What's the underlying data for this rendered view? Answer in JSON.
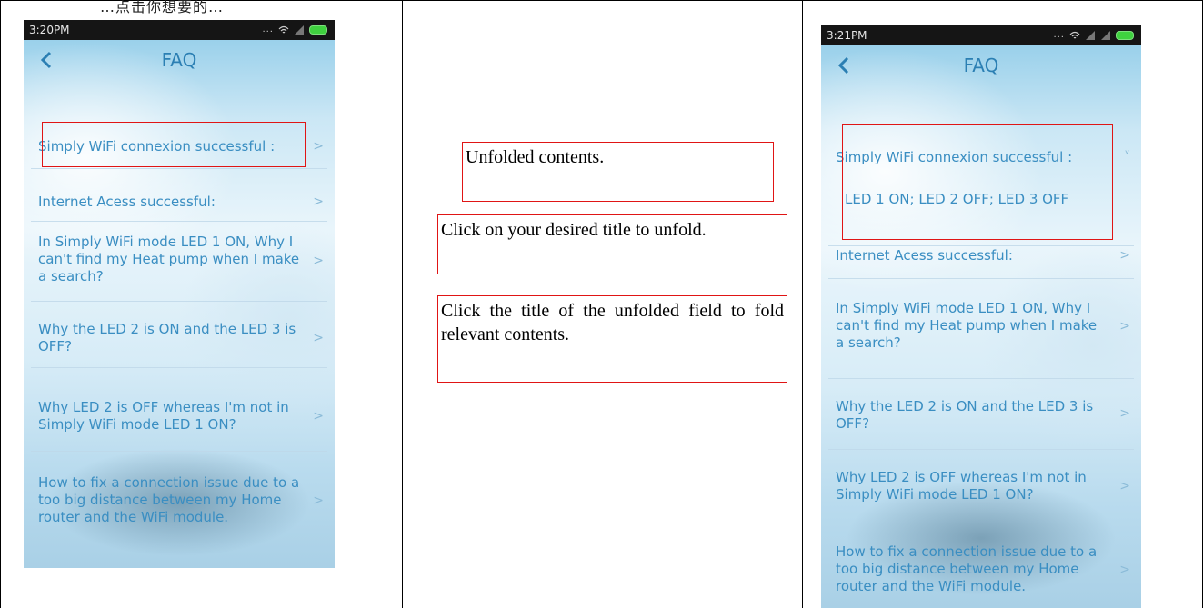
{
  "header_fragment": "…点击你想要的…",
  "left_phone": {
    "status_time": "3:20PM",
    "status_dots": "...",
    "title": "FAQ",
    "items": [
      {
        "text": "Simply WiFi connexion successful :",
        "chevron": ">"
      },
      {
        "text": "Internet Acess successful:",
        "chevron": ">"
      },
      {
        "text": "In Simply WiFi mode LED 1 ON, Why I can't find my Heat pump when I make a search?",
        "chevron": ">"
      },
      {
        "text": "Why the LED 2 is ON and the LED 3 is OFF?",
        "chevron": ">"
      },
      {
        "text": "Why LED 2 is OFF whereas I'm not in Simply WiFi mode LED 1 ON?",
        "chevron": ">"
      },
      {
        "text": "How to fix a connection issue due to a too big distance between my Home router and the WiFi module.",
        "chevron": ">"
      }
    ]
  },
  "notes": {
    "unfolded": "Unfolded contents.",
    "click_title": "Click on your desired title to unfold.",
    "click_fold": "Click the title of the unfolded field to fold relevant contents."
  },
  "right_phone": {
    "status_time": "3:21PM",
    "status_dots": "...",
    "title": "FAQ",
    "expanded_item": {
      "text": "Simply WiFi connexion successful :",
      "chevron": "˅",
      "answer": "LED 1 ON; LED 2 OFF; LED 3 OFF"
    },
    "items": [
      {
        "text": "Internet Acess successful:",
        "chevron": ">"
      },
      {
        "text": "In Simply WiFi mode LED 1 ON, Why I can't find my Heat pump when I make a search?",
        "chevron": ">"
      },
      {
        "text": "Why the LED 2 is ON and the LED 3 is OFF?",
        "chevron": ">"
      },
      {
        "text": "Why LED 2 is OFF whereas I'm not in Simply WiFi mode LED 1 ON?",
        "chevron": ">"
      },
      {
        "text": "How to fix a connection issue due to a too big distance between my Home router and the WiFi module.",
        "chevron": ">"
      }
    ]
  },
  "colors": {
    "accent": "#3a8ec2",
    "highlight": "#e01515"
  }
}
